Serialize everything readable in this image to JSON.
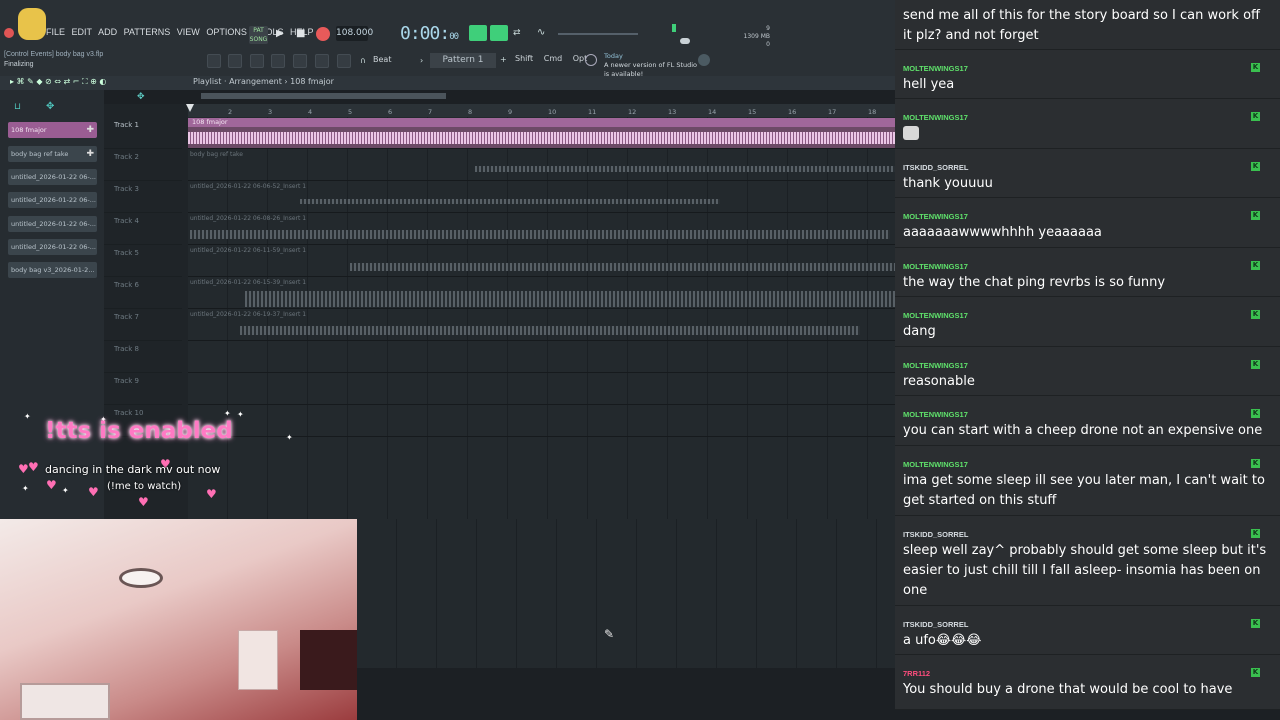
{
  "menu": [
    "FILE",
    "EDIT",
    "ADD",
    "PATTERNS",
    "VIEW",
    "OPTIONS",
    "TOOLS",
    "HELP"
  ],
  "song_info": "[Control Events] body bag v3.flp",
  "status": "Finalizing",
  "transport": {
    "mode": "PAT SONG",
    "tempo": "108.000",
    "time": "0:00",
    "time_ms": "00",
    "cpu_mem": "1309 MB",
    "cpu_voices": "9",
    "cpu_zero": "0"
  },
  "snap": "Beat",
  "pattern": "Pattern 1",
  "mods": [
    "Shift",
    "Cmd",
    "Opt"
  ],
  "news": {
    "label": "Today",
    "text": "A newer version of FL Studio is available!"
  },
  "breadcrumb": "Playlist · Arrangement › 108 fmajor",
  "channels": [
    "108 fmajor",
    "body bag ref take",
    "untitled_2026-01-22 06-...",
    "untitled_2026-01-22 06-...",
    "untitled_2026-01-22 06-...",
    "untitled_2026-01-22 06-...",
    "body bag v3_2026-01-2..."
  ],
  "ruler": [
    "2",
    "3",
    "4",
    "5",
    "6",
    "7",
    "8",
    "9",
    "10",
    "11",
    "12",
    "13",
    "14",
    "15",
    "16",
    "17",
    "18"
  ],
  "tracks": [
    "Track 1",
    "Track 2",
    "Track 3",
    "Track 4",
    "Track 5",
    "Track 6",
    "Track 7",
    "Track 8",
    "Track 9",
    "Track 10"
  ],
  "clips": [
    "108 fmajor",
    "body bag ref take",
    "untitled_2026-01-22 06-06-52_Insert 1",
    "untitled_2026-01-22 06-08-26_Insert 1",
    "untitled_2026-01-22 06-11-59_Insert 1",
    "untitled_2026-01-22 06-15-39_Insert 1",
    "untitled_2026-01-22 06-19-37_Insert 1"
  ],
  "overlay": {
    "tts": "!tts is enabled",
    "dance": "dancing in the dark mv out now",
    "watch": "(!me to watch)"
  },
  "chat": [
    {
      "user": "",
      "text": "send me all of this for the story board so I can work off it plz? and not forget"
    },
    {
      "user": "MOLTENWINGS17",
      "text": "hell yea"
    },
    {
      "user": "MOLTENWINGS17",
      "text": ""
    },
    {
      "user": "ITSKIDD_SORREL",
      "text": "thank youuuu"
    },
    {
      "user": "MOLTENWINGS17",
      "text": "aaaaaaawwwwhhhh yeaaaaaa"
    },
    {
      "user": "MOLTENWINGS17",
      "text": "the way the chat ping revrbs is so funny"
    },
    {
      "user": "MOLTENWINGS17",
      "text": "dang"
    },
    {
      "user": "MOLTENWINGS17",
      "text": "reasonable"
    },
    {
      "user": "MOLTENWINGS17",
      "text": "you can start with a cheep drone not an expensive one"
    },
    {
      "user": "MOLTENWINGS17",
      "text": "ima get some sleep ill see you later man, I can't wait to get started on this stuff"
    },
    {
      "user": "ITSKIDD_SORREL",
      "text": "sleep well zay^ probably should get some sleep but it's easier to just chill till I fall asleep- insomia has been on one"
    },
    {
      "user": "ITSKIDD_SORREL",
      "text": "a ufo😂😂😂"
    },
    {
      "user": "7RR112",
      "text": "You should buy a drone that would be cool to have"
    }
  ],
  "colors": {
    "accent_pink": "#ff7ac4",
    "chat_user_green": "#5fe06b",
    "clip_pink": "#a0679a",
    "record_red": "#e85a5a"
  }
}
